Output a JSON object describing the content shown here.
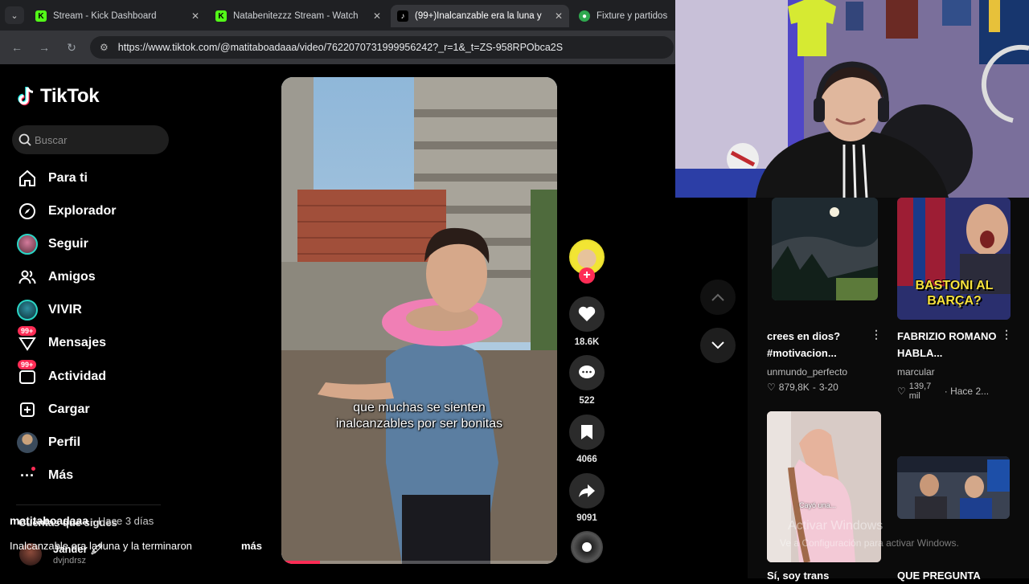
{
  "browser": {
    "tabs": [
      {
        "title": "Stream - Kick Dashboard",
        "icon": "kick-icon",
        "active": false
      },
      {
        "title": "Natabenitezzz Stream - Watch",
        "icon": "kick-icon",
        "active": false
      },
      {
        "title": "(99+)Inalcanzable era la luna y",
        "icon": "tiktok-icon",
        "active": true
      },
      {
        "title": "Fixture y partidos de",
        "icon": "globe-icon",
        "active": false
      }
    ],
    "url": "https://www.tiktok.com/@matitaboadaaa/video/7622070731999956242?_r=1&_t=ZS-958RPObca2S"
  },
  "tiktok": {
    "logo_text": "TikTok",
    "search_placeholder": "Buscar",
    "nav": [
      {
        "label": "Para ti",
        "icon": "home-icon"
      },
      {
        "label": "Explorador",
        "icon": "compass-icon"
      },
      {
        "label": "Seguir",
        "icon": "avatar-icon"
      },
      {
        "label": "Amigos",
        "icon": "friends-icon"
      },
      {
        "label": "VIVIR",
        "icon": "live-icon"
      },
      {
        "label": "Mensajes",
        "icon": "messages-icon",
        "badge": "99+"
      },
      {
        "label": "Actividad",
        "icon": "activity-icon",
        "badge": "99+"
      },
      {
        "label": "Cargar",
        "icon": "upload-icon"
      },
      {
        "label": "Perfil",
        "icon": "profile-icon"
      },
      {
        "label": "Más",
        "icon": "more-icon"
      }
    ],
    "following_title": "Cuentas que sigues",
    "following": [
      {
        "name": "Jander 🖍",
        "handle": "dvjndrsz"
      }
    ]
  },
  "video": {
    "caption_lines": [
      "que muchas se sienten",
      "inalcanzables por ser bonitas"
    ],
    "author": "matitaboadaaa",
    "age": "· Hace 3 días",
    "description": "Inalcanzable era la luna y la terminaron",
    "more": "más",
    "progress": 0.14,
    "likes": "18.6K",
    "comments": "522",
    "saves": "4066",
    "shares": "9091"
  },
  "recommendations": [
    {
      "title": "crees en dios? #motivacion...",
      "user": "unmundo_perfecto",
      "likes": "879,8K",
      "date": "3-20"
    },
    {
      "title": "FABRIZIO ROMANO HABLA...",
      "user": "marcular",
      "likes": "139,7 mil",
      "date": "· Hace 2...",
      "thumb_text": "BASTONI AL BARÇA?"
    },
    {
      "title": "Sí, soy trans",
      "overlay": "Cayó una...",
      "user": "",
      "likes": "",
      "date": ""
    },
    {
      "title": "QUE PREGUNTA",
      "user": "",
      "likes": "",
      "date": ""
    }
  ],
  "windows_watermark": {
    "line1": "Activar Windows",
    "line2": "Ve a Configuración para activar Windows."
  },
  "colors": {
    "accent": "#fe2c55",
    "background": "#000000",
    "chrome": "#35363a"
  }
}
